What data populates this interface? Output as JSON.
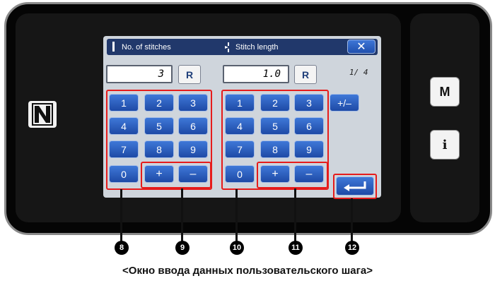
{
  "window": {
    "tab_stitches": "No. of stitches",
    "tab_length": "Stitch length",
    "close_label": "✕",
    "stitches_value": "3",
    "length_value": "1.0",
    "r_label": "R",
    "page_indicator": "1/ 4",
    "plus_minus_label": "+/–"
  },
  "left_keypad": [
    "1",
    "2",
    "3",
    "4",
    "5",
    "6",
    "7",
    "8",
    "9",
    "0",
    "+",
    "–"
  ],
  "right_keypad": [
    "1",
    "2",
    "3",
    "4",
    "5",
    "6",
    "7",
    "8",
    "9",
    "0",
    "+",
    "–"
  ],
  "side_buttons": {
    "m_label": "M",
    "info_label": "i"
  },
  "markers": [
    "8",
    "9",
    "10",
    "11",
    "12"
  ],
  "caption": "<Окно ввода данных пользовательского шага>",
  "colors": {
    "key_blue": "#2f63c7",
    "header_navy": "#21386b",
    "highlight_red": "#e61b1b"
  },
  "icons": [
    "nfc-icon",
    "enter-icon",
    "close-icon"
  ]
}
